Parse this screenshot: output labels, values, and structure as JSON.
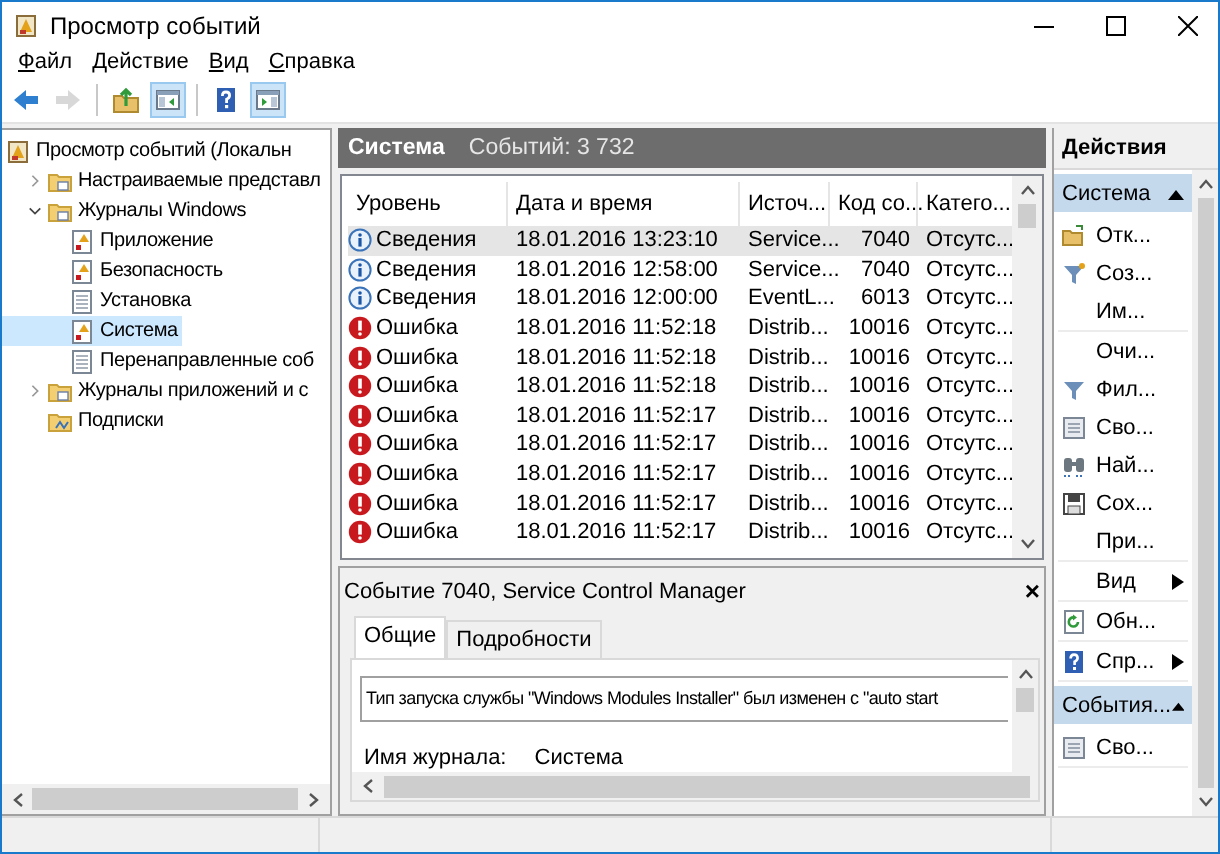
{
  "window": {
    "title": "Просмотр событий"
  },
  "menu": [
    "Файл",
    "Действие",
    "Вид",
    "Справка"
  ],
  "toolbar": [
    {
      "kind": "back",
      "disabled": false,
      "pressed": false
    },
    {
      "kind": "forward",
      "disabled": true,
      "pressed": false
    },
    {
      "kind": "separator"
    },
    {
      "kind": "up",
      "disabled": false,
      "pressed": false
    },
    {
      "kind": "tree",
      "disabled": false,
      "pressed": true
    },
    {
      "kind": "separator"
    },
    {
      "kind": "help",
      "disabled": false,
      "pressed": false
    },
    {
      "kind": "pane",
      "disabled": false,
      "pressed": true
    }
  ],
  "tree": [
    {
      "label": "Просмотр событий (Локальн",
      "kind": "root",
      "selected": false,
      "children": [
        {
          "label": "Настраиваемые представл",
          "kind": "folder",
          "expanded": false,
          "selected": false
        },
        {
          "label": "Журналы Windows",
          "kind": "folder",
          "expanded": true,
          "selected": false,
          "children": [
            {
              "label": "Приложение",
              "kind": "log-alert",
              "selected": false
            },
            {
              "label": "Безопасность",
              "kind": "log-alert",
              "selected": false
            },
            {
              "label": "Установка",
              "kind": "log",
              "selected": false
            },
            {
              "label": "Система",
              "kind": "log-alert",
              "selected": true
            },
            {
              "label": "Перенаправленные соб",
              "kind": "log",
              "selected": false
            }
          ]
        },
        {
          "label": "Журналы приложений и с",
          "kind": "folder",
          "expanded": false,
          "selected": false
        },
        {
          "label": "Подписки",
          "kind": "subscriptions",
          "selected": false
        }
      ]
    }
  ],
  "log_header": {
    "name": "Система",
    "count": "Событий: 3 732"
  },
  "table": {
    "columns": [
      "Уровень",
      "Дата и время",
      "Источ...",
      "Код со...",
      "Катего..."
    ],
    "rows": [
      {
        "kind": "info",
        "level": "Сведения",
        "date": "18.01.2016 13:23:10",
        "source": "Service...",
        "code": "7040",
        "category": "Отсутс...",
        "selected": true
      },
      {
        "kind": "info",
        "level": "Сведения",
        "date": "18.01.2016 12:58:00",
        "source": "Service...",
        "code": "7040",
        "category": "Отсутс...",
        "selected": false
      },
      {
        "kind": "info",
        "level": "Сведения",
        "date": "18.01.2016 12:00:00",
        "source": "EventL...",
        "code": "6013",
        "category": "Отсутс...",
        "selected": false
      },
      {
        "kind": "error",
        "level": "Ошибка",
        "date": "18.01.2016 11:52:18",
        "source": "Distrib...",
        "code": "10016",
        "category": "Отсутс...",
        "selected": false
      },
      {
        "kind": "error",
        "level": "Ошибка",
        "date": "18.01.2016 11:52:18",
        "source": "Distrib...",
        "code": "10016",
        "category": "Отсутс...",
        "selected": false
      },
      {
        "kind": "error",
        "level": "Ошибка",
        "date": "18.01.2016 11:52:18",
        "source": "Distrib...",
        "code": "10016",
        "category": "Отсутс...",
        "selected": false
      },
      {
        "kind": "error",
        "level": "Ошибка",
        "date": "18.01.2016 11:52:17",
        "source": "Distrib...",
        "code": "10016",
        "category": "Отсутс...",
        "selected": false
      },
      {
        "kind": "error",
        "level": "Ошибка",
        "date": "18.01.2016 11:52:17",
        "source": "Distrib...",
        "code": "10016",
        "category": "Отсутс...",
        "selected": false
      },
      {
        "kind": "error",
        "level": "Ошибка",
        "date": "18.01.2016 11:52:17",
        "source": "Distrib...",
        "code": "10016",
        "category": "Отсутс...",
        "selected": false
      },
      {
        "kind": "error",
        "level": "Ошибка",
        "date": "18.01.2016 11:52:17",
        "source": "Distrib...",
        "code": "10016",
        "category": "Отсутс...",
        "selected": false
      },
      {
        "kind": "error",
        "level": "Ошибка",
        "date": "18.01.2016 11:52:17",
        "source": "Distrib...",
        "code": "10016",
        "category": "Отсутс...",
        "selected": false
      }
    ]
  },
  "details": {
    "title": "Событие 7040, Service Control Manager",
    "close": "×",
    "tabs": [
      {
        "label": "Общие",
        "selected": true
      },
      {
        "label": "Подробности",
        "selected": false
      }
    ],
    "message": "Тип запуска службы \"Windows Modules Installer\" был изменен с \"auto start",
    "fields": [
      {
        "label": "Имя журнала:",
        "value": "Система"
      }
    ]
  },
  "actions": {
    "title": "Действия",
    "sections": [
      {
        "title": "Система",
        "expanded": true,
        "groups": [
          [
            {
              "label": "Отк...",
              "kind": "open",
              "submenu": false
            },
            {
              "label": "Соз...",
              "kind": "filter-new",
              "submenu": false
            },
            {
              "label": "Им...",
              "kind": "none",
              "submenu": false
            }
          ],
          [
            {
              "label": "Очи...",
              "kind": "none",
              "submenu": false
            },
            {
              "label": "Фил...",
              "kind": "filter",
              "submenu": false
            },
            {
              "label": "Сво...",
              "kind": "properties",
              "submenu": false
            },
            {
              "label": "Най...",
              "kind": "find",
              "submenu": false
            },
            {
              "label": "Сох...",
              "kind": "save",
              "submenu": false
            },
            {
              "label": "При...",
              "kind": "none",
              "submenu": false
            }
          ],
          [
            {
              "label": "Вид",
              "kind": "none",
              "submenu": true
            }
          ],
          [
            {
              "label": "Обн...",
              "kind": "refresh",
              "submenu": false
            }
          ],
          [
            {
              "label": "Спр...",
              "kind": "help",
              "submenu": true
            }
          ]
        ]
      },
      {
        "title": "События...",
        "expanded": true,
        "groups": [
          [
            {
              "label": "Сво...",
              "kind": "properties",
              "submenu": false
            }
          ]
        ]
      }
    ]
  }
}
